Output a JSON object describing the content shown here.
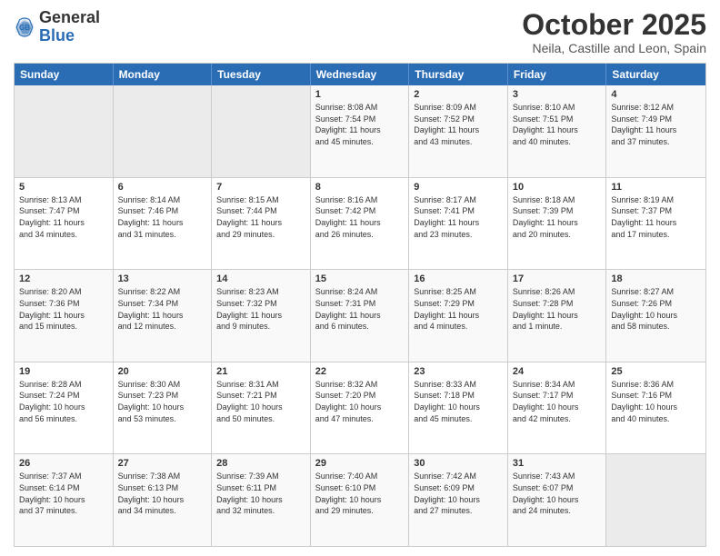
{
  "header": {
    "logo_general": "General",
    "logo_blue": "Blue",
    "month_title": "October 2025",
    "location": "Neila, Castille and Leon, Spain"
  },
  "weekdays": [
    "Sunday",
    "Monday",
    "Tuesday",
    "Wednesday",
    "Thursday",
    "Friday",
    "Saturday"
  ],
  "rows": [
    [
      {
        "day": "",
        "info": ""
      },
      {
        "day": "",
        "info": ""
      },
      {
        "day": "",
        "info": ""
      },
      {
        "day": "1",
        "info": "Sunrise: 8:08 AM\nSunset: 7:54 PM\nDaylight: 11 hours\nand 45 minutes."
      },
      {
        "day": "2",
        "info": "Sunrise: 8:09 AM\nSunset: 7:52 PM\nDaylight: 11 hours\nand 43 minutes."
      },
      {
        "day": "3",
        "info": "Sunrise: 8:10 AM\nSunset: 7:51 PM\nDaylight: 11 hours\nand 40 minutes."
      },
      {
        "day": "4",
        "info": "Sunrise: 8:12 AM\nSunset: 7:49 PM\nDaylight: 11 hours\nand 37 minutes."
      }
    ],
    [
      {
        "day": "5",
        "info": "Sunrise: 8:13 AM\nSunset: 7:47 PM\nDaylight: 11 hours\nand 34 minutes."
      },
      {
        "day": "6",
        "info": "Sunrise: 8:14 AM\nSunset: 7:46 PM\nDaylight: 11 hours\nand 31 minutes."
      },
      {
        "day": "7",
        "info": "Sunrise: 8:15 AM\nSunset: 7:44 PM\nDaylight: 11 hours\nand 29 minutes."
      },
      {
        "day": "8",
        "info": "Sunrise: 8:16 AM\nSunset: 7:42 PM\nDaylight: 11 hours\nand 26 minutes."
      },
      {
        "day": "9",
        "info": "Sunrise: 8:17 AM\nSunset: 7:41 PM\nDaylight: 11 hours\nand 23 minutes."
      },
      {
        "day": "10",
        "info": "Sunrise: 8:18 AM\nSunset: 7:39 PM\nDaylight: 11 hours\nand 20 minutes."
      },
      {
        "day": "11",
        "info": "Sunrise: 8:19 AM\nSunset: 7:37 PM\nDaylight: 11 hours\nand 17 minutes."
      }
    ],
    [
      {
        "day": "12",
        "info": "Sunrise: 8:20 AM\nSunset: 7:36 PM\nDaylight: 11 hours\nand 15 minutes."
      },
      {
        "day": "13",
        "info": "Sunrise: 8:22 AM\nSunset: 7:34 PM\nDaylight: 11 hours\nand 12 minutes."
      },
      {
        "day": "14",
        "info": "Sunrise: 8:23 AM\nSunset: 7:32 PM\nDaylight: 11 hours\nand 9 minutes."
      },
      {
        "day": "15",
        "info": "Sunrise: 8:24 AM\nSunset: 7:31 PM\nDaylight: 11 hours\nand 6 minutes."
      },
      {
        "day": "16",
        "info": "Sunrise: 8:25 AM\nSunset: 7:29 PM\nDaylight: 11 hours\nand 4 minutes."
      },
      {
        "day": "17",
        "info": "Sunrise: 8:26 AM\nSunset: 7:28 PM\nDaylight: 11 hours\nand 1 minute."
      },
      {
        "day": "18",
        "info": "Sunrise: 8:27 AM\nSunset: 7:26 PM\nDaylight: 10 hours\nand 58 minutes."
      }
    ],
    [
      {
        "day": "19",
        "info": "Sunrise: 8:28 AM\nSunset: 7:24 PM\nDaylight: 10 hours\nand 56 minutes."
      },
      {
        "day": "20",
        "info": "Sunrise: 8:30 AM\nSunset: 7:23 PM\nDaylight: 10 hours\nand 53 minutes."
      },
      {
        "day": "21",
        "info": "Sunrise: 8:31 AM\nSunset: 7:21 PM\nDaylight: 10 hours\nand 50 minutes."
      },
      {
        "day": "22",
        "info": "Sunrise: 8:32 AM\nSunset: 7:20 PM\nDaylight: 10 hours\nand 47 minutes."
      },
      {
        "day": "23",
        "info": "Sunrise: 8:33 AM\nSunset: 7:18 PM\nDaylight: 10 hours\nand 45 minutes."
      },
      {
        "day": "24",
        "info": "Sunrise: 8:34 AM\nSunset: 7:17 PM\nDaylight: 10 hours\nand 42 minutes."
      },
      {
        "day": "25",
        "info": "Sunrise: 8:36 AM\nSunset: 7:16 PM\nDaylight: 10 hours\nand 40 minutes."
      }
    ],
    [
      {
        "day": "26",
        "info": "Sunrise: 7:37 AM\nSunset: 6:14 PM\nDaylight: 10 hours\nand 37 minutes."
      },
      {
        "day": "27",
        "info": "Sunrise: 7:38 AM\nSunset: 6:13 PM\nDaylight: 10 hours\nand 34 minutes."
      },
      {
        "day": "28",
        "info": "Sunrise: 7:39 AM\nSunset: 6:11 PM\nDaylight: 10 hours\nand 32 minutes."
      },
      {
        "day": "29",
        "info": "Sunrise: 7:40 AM\nSunset: 6:10 PM\nDaylight: 10 hours\nand 29 minutes."
      },
      {
        "day": "30",
        "info": "Sunrise: 7:42 AM\nSunset: 6:09 PM\nDaylight: 10 hours\nand 27 minutes."
      },
      {
        "day": "31",
        "info": "Sunrise: 7:43 AM\nSunset: 6:07 PM\nDaylight: 10 hours\nand 24 minutes."
      },
      {
        "day": "",
        "info": ""
      }
    ]
  ]
}
